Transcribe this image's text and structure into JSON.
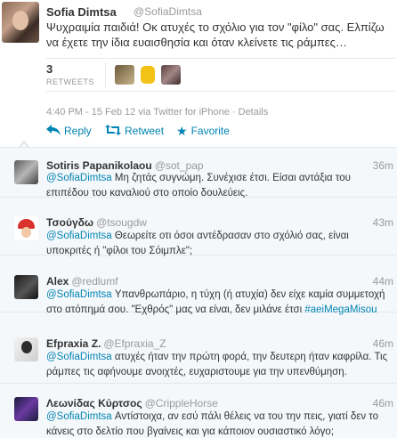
{
  "tweet": {
    "name": "Sofia Dimtsa",
    "handle": "@SofiaDimtsa",
    "text": "Ψυχραιμία παιδιά! Οκ ατυχές το σχόλιο για τον \"φίλο\" σας. Ελπίζω να έχετε την ίδια ευαισθησία και όταν κλείνετε τις ράμπες…",
    "retweet_count": "3",
    "retweet_label": "RETWEETS",
    "meta": "4:40 PM - 15 Feb 12 via Twitter for iPhone · Details",
    "actions": {
      "reply": "Reply",
      "retweet": "Retweet",
      "favorite": "Favorite"
    }
  },
  "replies": [
    {
      "name": "Sotiris Papanikolaou",
      "handle": "@sot_pap",
      "time": "36m",
      "mention": "@SofiaDimtsa",
      "text": " Μη ζητάς συγνώμη. Συνέχισε έτσι. Είσαι αντάξια του επιπέδου του καναλιού στο οποίο δουλεύεις.",
      "hashtag": ""
    },
    {
      "name": "Τσούγδω",
      "handle": "@tsougdw",
      "time": "43m",
      "mention": "@SofiaDimtsa",
      "text": " Θεωρείτε οτι όσοι αντέδρασαν στο σχόλιό σας, είναι υποκριτές ή \"φίλοι του Σόιμπλε\";",
      "hashtag": ""
    },
    {
      "name": "Alex",
      "handle": "@redlumf",
      "time": "44m",
      "mention": "@SofiaDimtsa",
      "text": " Υπανθρωπάριο, η τύχη (ή ατυχία) δεν είχε καμία συμμετοχή στο ατόπημά σου. \"Εχθρός\" μας να είναι, δεν μιλάνε έτσι ",
      "hashtag": "#aeiMegaMisou"
    },
    {
      "name": "Efpraxia Z.",
      "handle": "@Efpraxia_Z",
      "time": "46m",
      "mention": "@SofiaDimtsa",
      "text": " ατυχές ήταν την πρώτη φορά, την δευτερη ήταν καφρίλα. Τις ράμπες τις αφήνουμε ανοιχτές, ευχαριστουμε για την υπενθύμηση.",
      "hashtag": ""
    },
    {
      "name": "Λεωνίδας Κύρτσος",
      "handle": "@CrippleHorse",
      "time": "46m",
      "mention": "@SofiaDimtsa",
      "text": " Αντίστοιχα, αν εσύ πάλι θέλεις να του την πεις, γιατί δεν το κάνεις στο δελτίο που βγαίνεις και για κάποιον ουσιαστικό λόγο;",
      "hashtag": ""
    }
  ]
}
